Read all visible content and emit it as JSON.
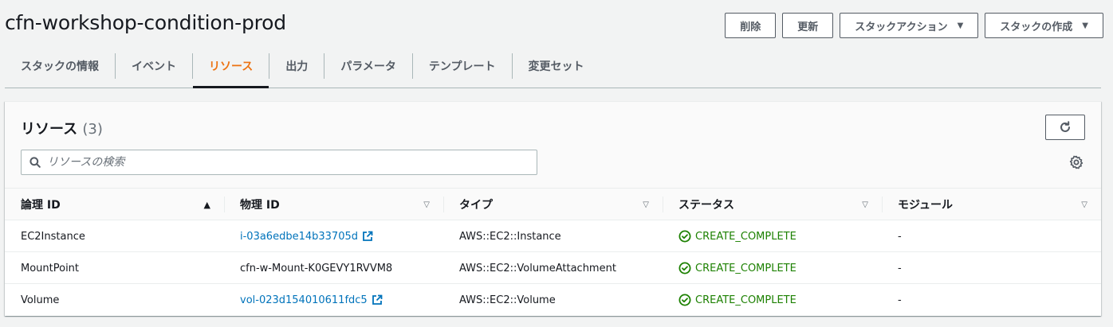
{
  "stack": {
    "title": "cfn-workshop-condition-prod"
  },
  "actions": {
    "delete": "削除",
    "update": "更新",
    "stack_actions": "スタックアクション",
    "create_stack": "スタックの作成"
  },
  "tabs": [
    {
      "label": "スタックの情報"
    },
    {
      "label": "イベント"
    },
    {
      "label": "リソース"
    },
    {
      "label": "出力"
    },
    {
      "label": "パラメータ"
    },
    {
      "label": "テンプレート"
    },
    {
      "label": "変更セット"
    }
  ],
  "resources": {
    "title": "リソース",
    "count": "(3)",
    "search_placeholder": "リソースの検索",
    "columns": [
      "論理 ID",
      "物理 ID",
      "タイプ",
      "ステータス",
      "モジュール"
    ],
    "rows": [
      {
        "logical_id": "EC2Instance",
        "physical_id": "i-03a6edbe14b33705d",
        "physical_link": true,
        "type": "AWS::EC2::Instance",
        "status": "CREATE_COMPLETE",
        "module": "-"
      },
      {
        "logical_id": "MountPoint",
        "physical_id": "cfn-w-Mount-K0GEVY1RVVM8",
        "physical_link": false,
        "type": "AWS::EC2::VolumeAttachment",
        "status": "CREATE_COMPLETE",
        "module": "-"
      },
      {
        "logical_id": "Volume",
        "physical_id": "vol-023d154010611fdc5",
        "physical_link": true,
        "type": "AWS::EC2::Volume",
        "status": "CREATE_COMPLETE",
        "module": "-"
      }
    ]
  },
  "colors": {
    "accent": "#ec7211",
    "link": "#0073bb",
    "success": "#1d8102"
  },
  "icons": {
    "search": "search-icon",
    "refresh": "refresh-icon",
    "settings": "gear-icon",
    "external": "external-link-icon",
    "status": "check-circle-icon"
  }
}
